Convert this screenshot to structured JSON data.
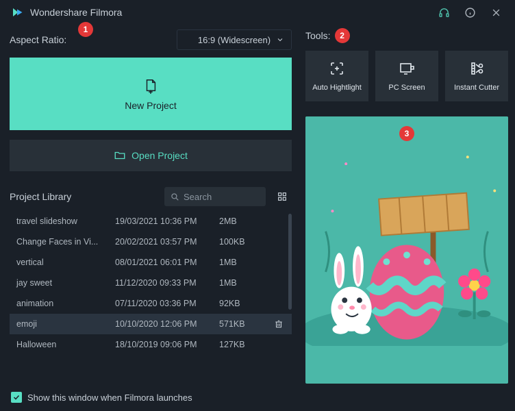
{
  "titlebar": {
    "app_name": "Wondershare Filmora"
  },
  "aspect": {
    "label": "Aspect Ratio:",
    "selected": "16:9 (Widescreen)"
  },
  "buttons": {
    "new_project": "New Project",
    "open_project": "Open Project"
  },
  "library": {
    "title": "Project Library",
    "search_placeholder": "Search",
    "rows": [
      {
        "name": "travel slideshow",
        "date": "19/03/2021 10:36 PM",
        "size": "2MB"
      },
      {
        "name": "Change Faces in Vi...",
        "date": "20/02/2021 03:57 PM",
        "size": "100KB"
      },
      {
        "name": "vertical",
        "date": "08/01/2021 06:01 PM",
        "size": "1MB"
      },
      {
        "name": "jay sweet",
        "date": "11/12/2020 09:33 PM",
        "size": "1MB"
      },
      {
        "name": "animation",
        "date": "07/11/2020 03:36 PM",
        "size": "92KB"
      },
      {
        "name": "emoji",
        "date": "10/10/2020 12:06 PM",
        "size": "571KB",
        "selected": true
      },
      {
        "name": "Halloween",
        "date": "18/10/2019 09:06 PM",
        "size": "127KB"
      }
    ]
  },
  "tools": {
    "label": "Tools:",
    "items": [
      {
        "id": "auto-highlight",
        "label": "Auto Hightlight"
      },
      {
        "id": "pc-screen",
        "label": "PC Screen"
      },
      {
        "id": "instant-cutter",
        "label": "Instant Cutter"
      }
    ]
  },
  "markers": {
    "m1": "1",
    "m2": "2",
    "m3": "3"
  },
  "footer": {
    "show_on_launch": "Show this window when Filmora launches"
  },
  "colors": {
    "accent": "#58dec3",
    "bg": "#1a2028",
    "panel": "#283038",
    "preview_bg": "#4bb8a8"
  }
}
